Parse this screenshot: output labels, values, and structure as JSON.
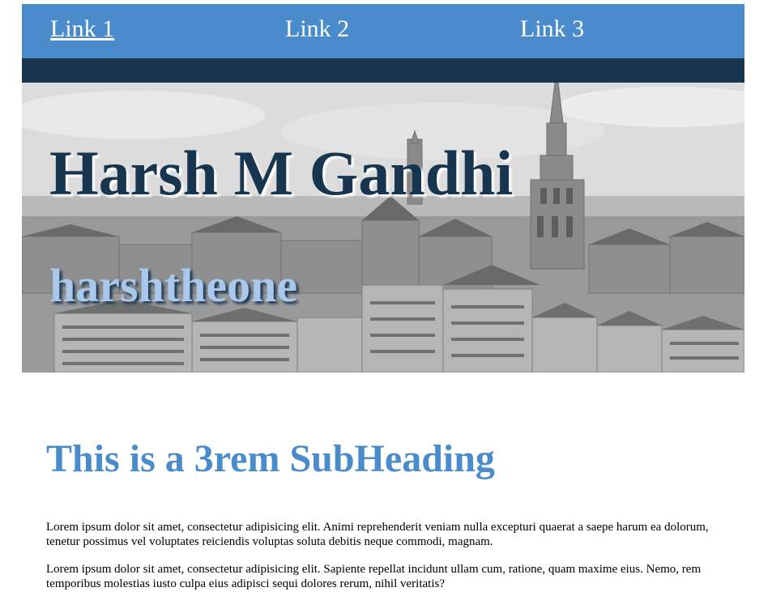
{
  "nav": {
    "links": [
      {
        "label": "Link 1",
        "active": true
      },
      {
        "label": "Link 2",
        "active": false
      },
      {
        "label": "Link 3",
        "active": false
      }
    ]
  },
  "hero": {
    "title": "Harsh M Gandhi",
    "subtitle": "harshtheone"
  },
  "content": {
    "subheading": "This is a 3rem SubHeading",
    "paragraphs": [
      "Lorem ipsum dolor sit amet, consectetur adipisicing elit. Animi reprehenderit veniam nulla excepturi quaerat a saepe harum ea dolorum, tenetur possimus vel voluptates reiciendis voluptas soluta debitis neque commodi, magnam.",
      "Lorem ipsum dolor sit amet, consectetur adipisicing elit. Sapiente repellat incidunt ullam cum, ratione, quam maxime eius. Nemo, rem temporibus molestias iusto culpa eius adipisci sequi dolores rerum, nihil veritatis?"
    ]
  },
  "colors": {
    "nav_bg": "#4a8ccb",
    "bar_bg": "#183550",
    "title": "#183550",
    "subtitle": "#a9c8eb",
    "subheading": "#4a8ccb"
  }
}
